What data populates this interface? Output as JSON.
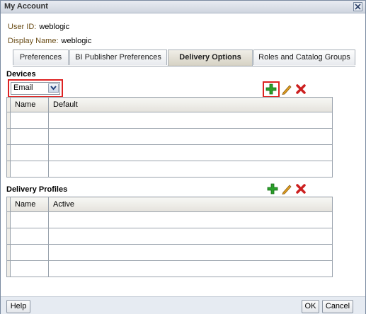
{
  "window": {
    "title": "My Account"
  },
  "fields": {
    "user_id_label": "User ID:",
    "user_id_value": "weblogic",
    "display_name_label": "Display Name:",
    "display_name_value": "weblogic"
  },
  "tabs": [
    {
      "label": "Preferences"
    },
    {
      "label": "BI Publisher Preferences"
    },
    {
      "label": "Delivery Options",
      "active": true
    },
    {
      "label": "Roles and Catalog Groups"
    }
  ],
  "devices": {
    "label": "Devices",
    "device_type": "Email",
    "columns": [
      "Name",
      "Default"
    ]
  },
  "delivery_profiles": {
    "label": "Delivery Profiles",
    "columns": [
      "Name",
      "Active"
    ]
  },
  "footer": {
    "help": "Help",
    "ok": "OK",
    "cancel": "Cancel"
  },
  "colors": {
    "highlight": "#dd2222",
    "add": "#2aa02a",
    "delete": "#cc1f1f",
    "edit": "#e0a020"
  },
  "icons": [
    "close-icon",
    "chevron-down-icon",
    "add-icon",
    "edit-icon",
    "delete-icon"
  ]
}
